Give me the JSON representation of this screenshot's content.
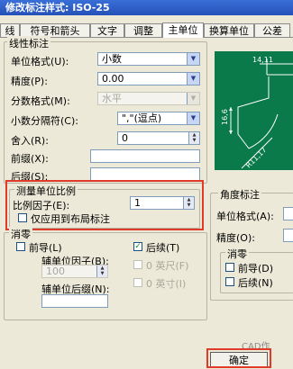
{
  "window": {
    "title": "修改标注样式: ISO-25"
  },
  "tabs": [
    {
      "label": "线"
    },
    {
      "label": "符号和箭头"
    },
    {
      "label": "文字"
    },
    {
      "label": "调整"
    },
    {
      "label": "主单位"
    },
    {
      "label": "换算单位"
    },
    {
      "label": "公差"
    }
  ],
  "active_tab": "主单位",
  "linear": {
    "group_title": "线性标注",
    "unit_format_label": "单位格式(U):",
    "unit_format_value": "小数",
    "precision_label": "精度(P):",
    "precision_value": "0.00",
    "fraction_label": "分数格式(M):",
    "fraction_value": "水平",
    "decimal_sep_label": "小数分隔符(C):",
    "decimal_sep_value": "\",\"(逗点)",
    "round_label": "舍入(R):",
    "round_value": "0",
    "prefix_label": "前缀(X):",
    "prefix_value": "",
    "suffix_label": "后缀(S):",
    "suffix_value": ""
  },
  "scale": {
    "group_title": "测量单位比例",
    "factor_label": "比例因子(E):",
    "factor_value": "1",
    "layout_only_label": "仅应用到布局标注",
    "layout_only_checked": false
  },
  "zero_suppress": {
    "group_title": "消零",
    "leading_label": "前导(L)",
    "leading_checked": false,
    "sub_factor_label": "辅单位因子(B):",
    "sub_factor_value": "100",
    "sub_suffix_label": "辅单位后缀(N):",
    "sub_suffix_value": "",
    "trailing_label": "后续(T)",
    "trailing_checked": true,
    "feet_label": "0 英尺(F)",
    "inch_label": "0 英寸(I)"
  },
  "angular": {
    "group_title": "角度标注",
    "unit_format_label": "单位格式(A):",
    "precision_label": "精度(O):",
    "zero_title": "消零",
    "leading_label": "前导(D)",
    "trailing_label": "后续(N)"
  },
  "preview": {
    "dim_1": "14,11",
    "dim_2": "16,6",
    "dim_3": "R11,17"
  },
  "buttons": {
    "ok": "确定"
  },
  "watermark": "CAD作",
  "colors": {
    "highlight": "#e03a2a",
    "preview_bg": "#0a7a4a",
    "title_bar": "#2f5fc8"
  }
}
